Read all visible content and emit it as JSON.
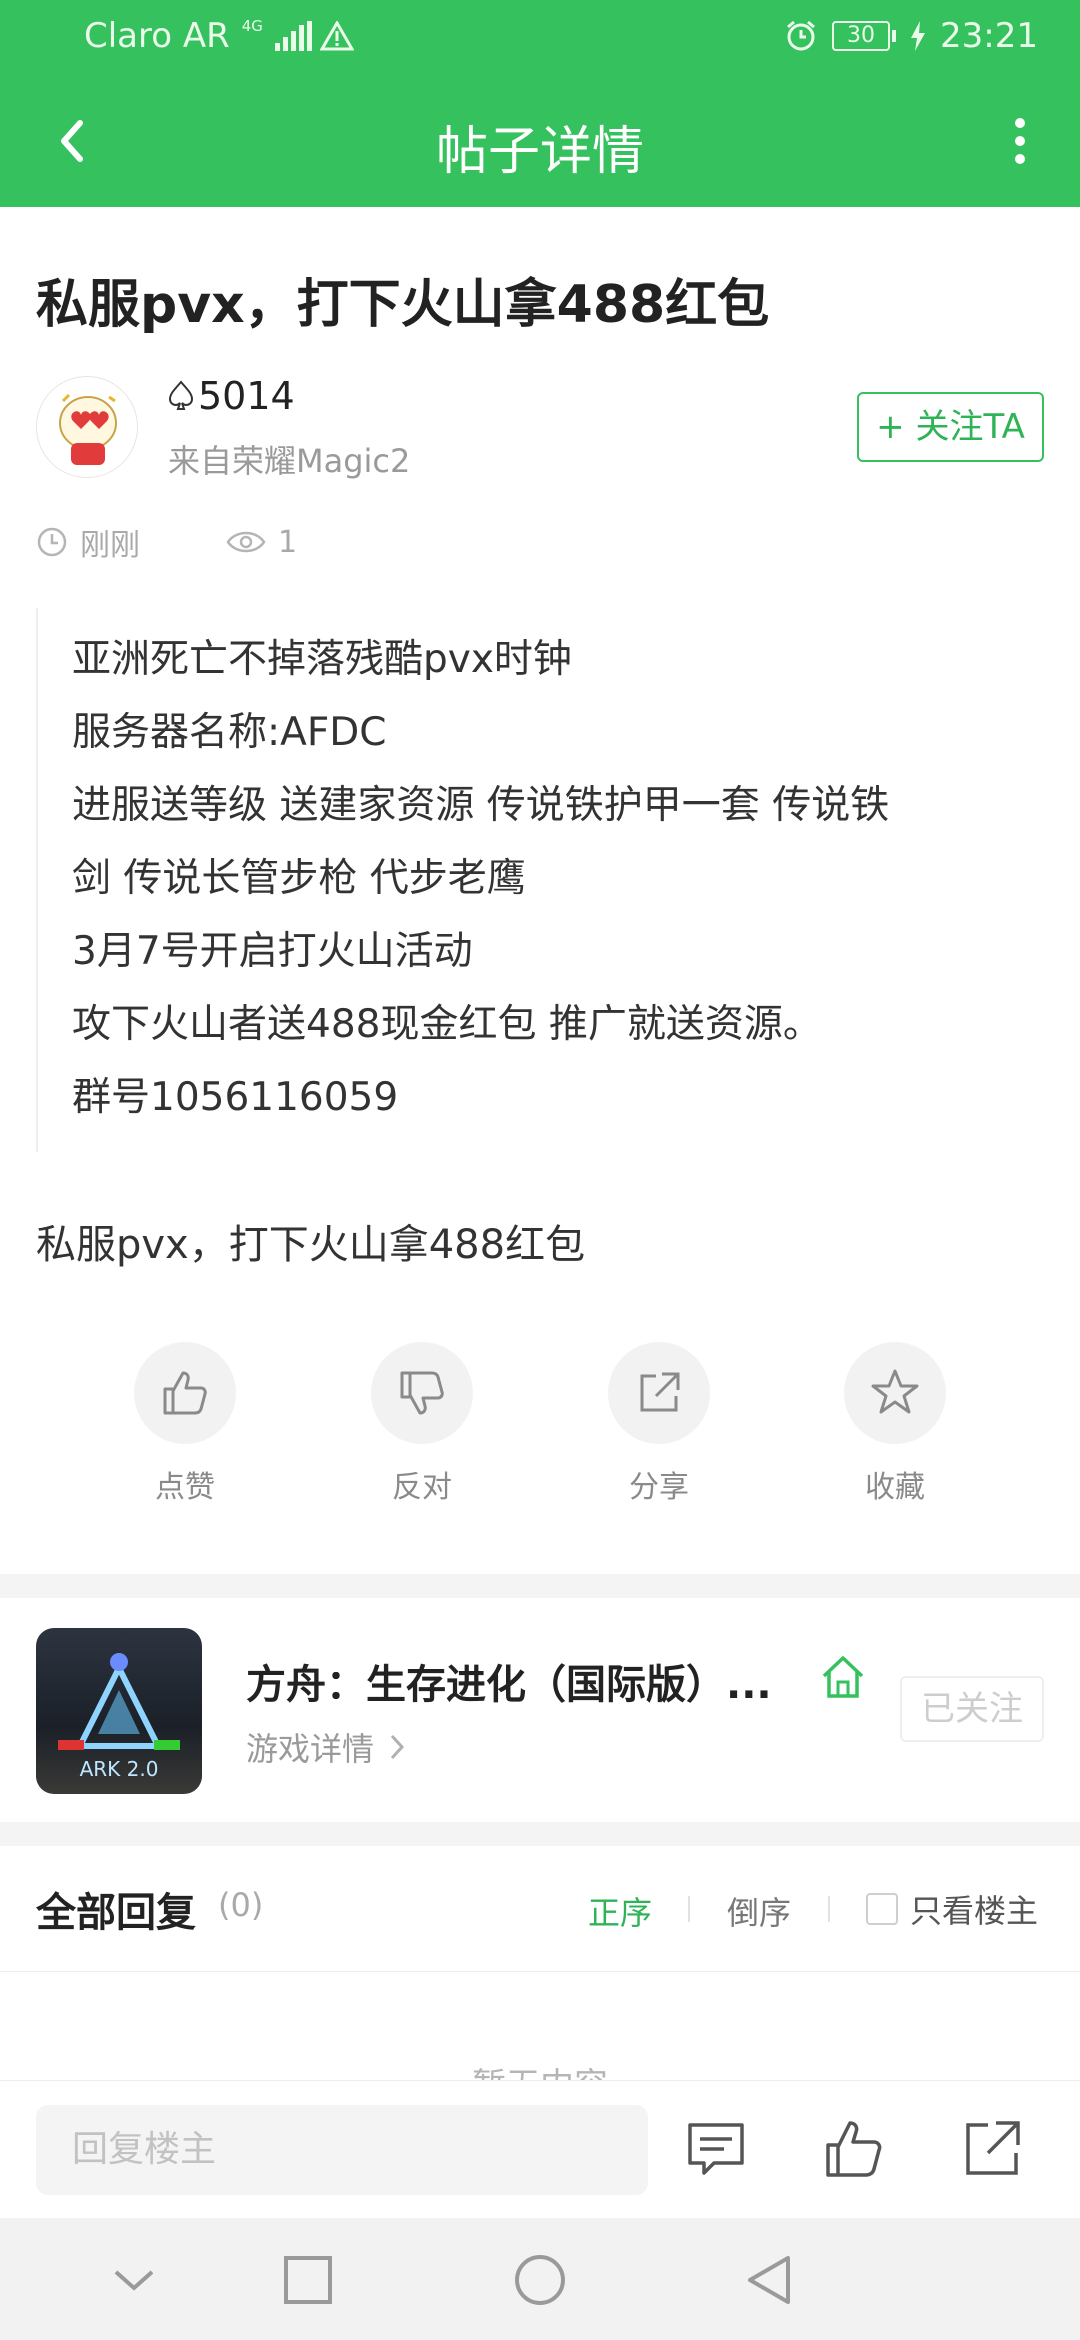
{
  "status_bar": {
    "carrier": "Claro AR",
    "network_badge": "4G",
    "battery": "30",
    "time": "23:21",
    "icons": [
      "signal-icon",
      "warning-icon",
      "alarm-icon",
      "battery-icon",
      "charging-icon"
    ]
  },
  "app_bar": {
    "title": "帖子详情",
    "icons": [
      "back-arrow-icon",
      "more-vertical-icon"
    ]
  },
  "post": {
    "title": "私服pvx，打下火山拿488红包",
    "author": {
      "name": "5014",
      "device": "来自荣耀Magic2",
      "follow_label": "+ 关注TA"
    },
    "time": "刚刚",
    "views": "1",
    "quote_lines": [
      "亚洲死亡不掉落残酷pvx时钟",
      "服务器名称:AFDC",
      "进服送等级    送建家资源  传说铁护甲一套  传说铁",
      "剑  传说长管步枪  代步老鹰",
      "3月7号开启打火山活动",
      "攻下火山者送488现金红包 推广就送资源。",
      "群号1056116059"
    ],
    "body": "私服pvx，打下火山拿488红包"
  },
  "actions": [
    {
      "label": "点赞",
      "icon": "thumbs-up-icon"
    },
    {
      "label": "反对",
      "icon": "thumbs-down-icon"
    },
    {
      "label": "分享",
      "icon": "share-icon"
    },
    {
      "label": "收藏",
      "icon": "star-icon"
    }
  ],
  "game": {
    "title": "方舟：生存进化（国际版）...",
    "details_label": "游戏详情",
    "followed_label": "已关注",
    "icon_text": "ARK 2.0"
  },
  "replies": {
    "title": "全部回复",
    "count": "(0)",
    "sort_asc": "正序",
    "sort_desc": "倒序",
    "only_owner": "只看楼主",
    "empty_hint": "暂无内容"
  },
  "reply_bar": {
    "placeholder": "回复楼主",
    "icons": [
      "comment-icon",
      "like-icon",
      "share-icon"
    ]
  },
  "nav_bar": {
    "icons": [
      "collapse-icon",
      "recents-icon",
      "home-icon",
      "back-icon"
    ]
  },
  "colors": {
    "accent": "#35c15d",
    "accent_text": "#2fb357",
    "muted": "#9a9a9a"
  }
}
